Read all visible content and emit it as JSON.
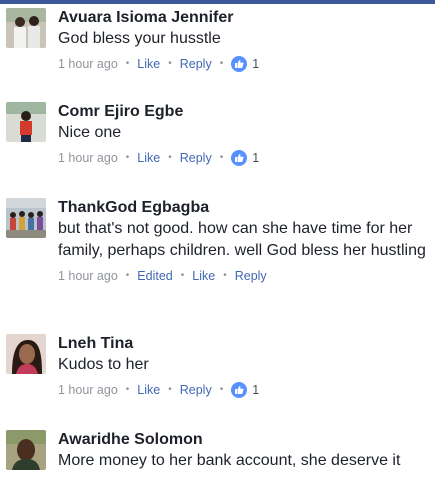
{
  "colors": {
    "brand": "#3b5998",
    "link": "#4267b2",
    "muted": "#90949c",
    "like_badge": "#5890ff"
  },
  "comments": [
    {
      "name": "Avuara Isioma Jennifer",
      "text": "God bless your husstle",
      "time": "1 hour ago",
      "like_label": "Like",
      "reply_label": "Reply",
      "reactions": "1"
    },
    {
      "name": "Comr Ejiro Egbe",
      "text": "Nice one",
      "time": "1 hour ago",
      "like_label": "Like",
      "reply_label": "Reply",
      "reactions": "1"
    },
    {
      "name": "ThankGod Egbagba",
      "text": "but that's not good. how can she have time for her family, perhaps children. well God bless her hustling",
      "time": "1 hour ago",
      "edited_label": "Edited",
      "like_label": "Like",
      "reply_label": "Reply"
    },
    {
      "name": "Lneh Tina",
      "text": "Kudos to her",
      "time": "1 hour ago",
      "like_label": "Like",
      "reply_label": "Reply",
      "reactions": "1"
    },
    {
      "name": "Awaridhe Solomon",
      "text": "More money to her bank account, she deserve it"
    }
  ]
}
